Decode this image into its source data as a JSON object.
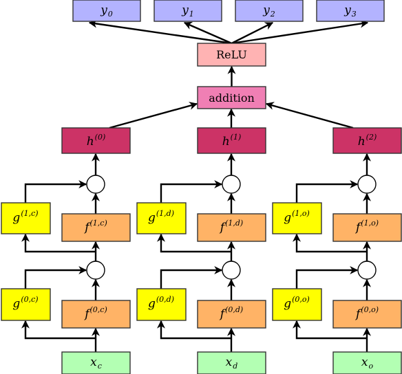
{
  "colors": {
    "output": "#b3b3ff",
    "relu": "#ffb3b3",
    "addition": "#f07fb4",
    "hidden": "#cc3366",
    "g": "#ffff00",
    "f": "#ffb366",
    "input": "#b3ffb3"
  },
  "outputs": [
    {
      "base": "y",
      "sub": "0"
    },
    {
      "base": "y",
      "sub": "1"
    },
    {
      "base": "y",
      "sub": "2"
    },
    {
      "base": "y",
      "sub": "3"
    }
  ],
  "relu_label": "ReLU",
  "addition_label": "addition",
  "columns": [
    {
      "hidden": {
        "base": "h",
        "sup": "(0)"
      },
      "g1": {
        "base": "g",
        "sup": "(1,c)"
      },
      "f1": {
        "base": "f",
        "sup": "(1,c)"
      },
      "g0": {
        "base": "g",
        "sup": "(0,c)"
      },
      "f0": {
        "base": "f",
        "sup": "(0,c)"
      },
      "input": {
        "base": "x",
        "sub": "c"
      }
    },
    {
      "hidden": {
        "base": "h",
        "sup": "(1)"
      },
      "g1": {
        "base": "g",
        "sup": "(1,d)"
      },
      "f1": {
        "base": "f",
        "sup": "(1,d)"
      },
      "g0": {
        "base": "g",
        "sup": "(0,d)"
      },
      "f0": {
        "base": "f",
        "sup": "(0,d)"
      },
      "input": {
        "base": "x",
        "sub": "d"
      }
    },
    {
      "hidden": {
        "base": "h",
        "sup": "(2)"
      },
      "g1": {
        "base": "g",
        "sup": "(1,o)"
      },
      "f1": {
        "base": "f",
        "sup": "(1,o)"
      },
      "g0": {
        "base": "g",
        "sup": "(0,o)"
      },
      "f0": {
        "base": "f",
        "sup": "(0,o)"
      },
      "input": {
        "base": "x",
        "sub": "o"
      }
    }
  ]
}
